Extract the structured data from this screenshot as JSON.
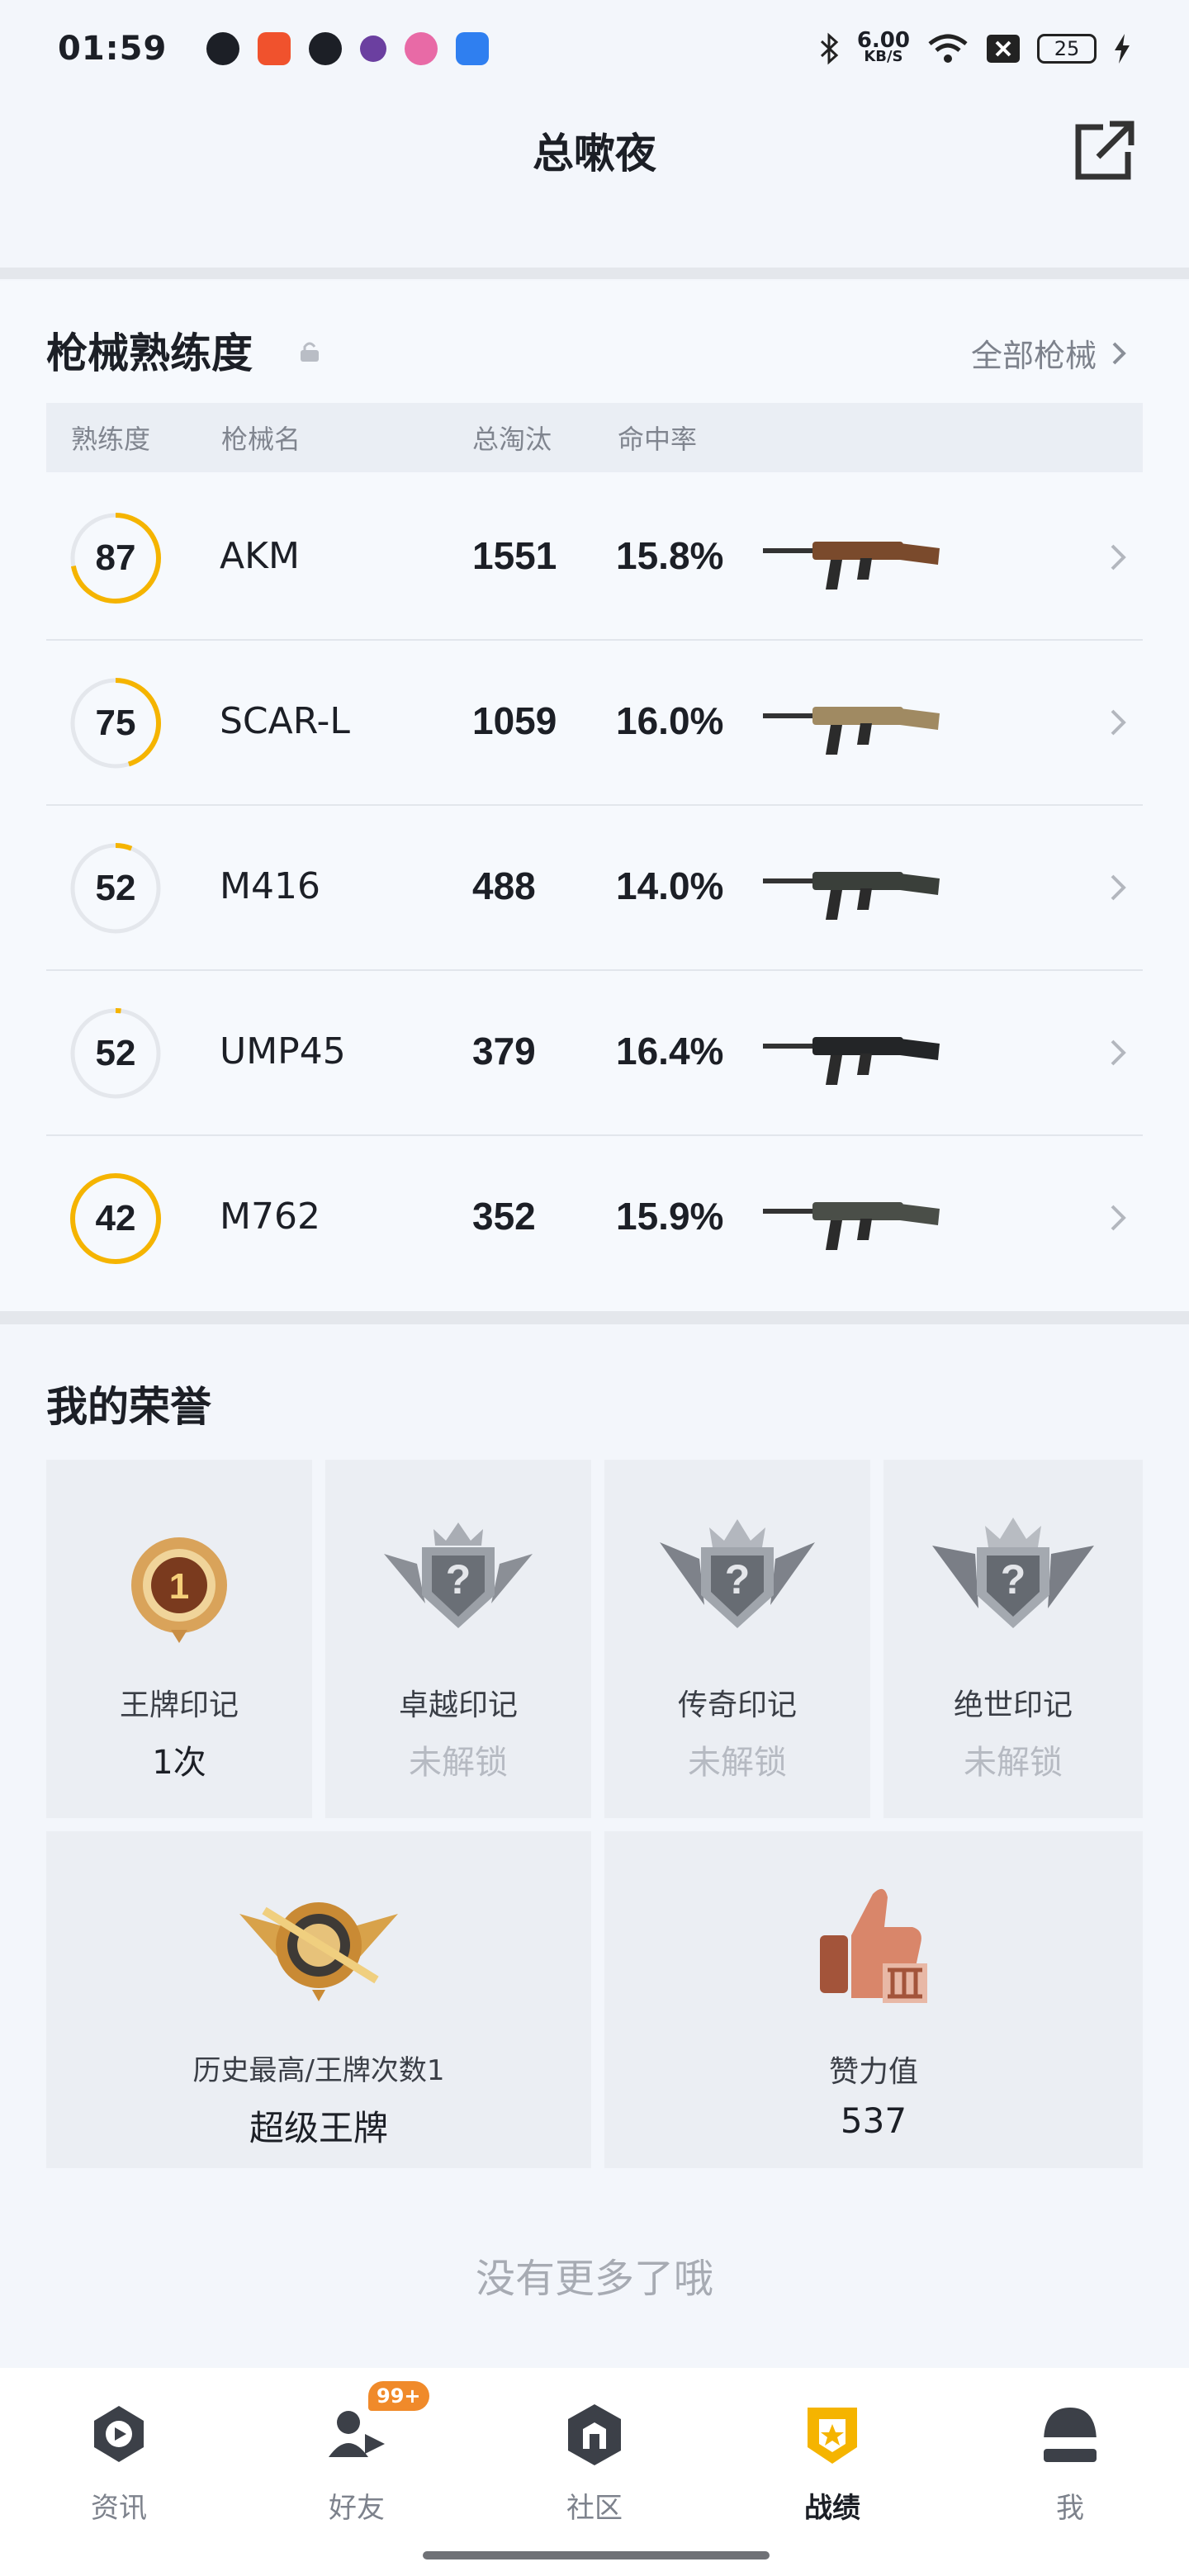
{
  "status_bar": {
    "time": "01:59",
    "speed_value": "6.00",
    "speed_unit": "KB/S",
    "battery": "25",
    "icons": [
      "wechat-icon",
      "video-icon",
      "tiktok-icon",
      "app-icon",
      "flower-icon",
      "bluetooth-app-icon",
      "bluetooth-icon",
      "wifi-icon",
      "no-sim-icon",
      "charging-icon"
    ]
  },
  "header": {
    "title": "总嗽夜",
    "share_icon": "share-external-icon"
  },
  "weapons": {
    "title": "枪械熟练度",
    "all_link": "全部枪械",
    "columns": [
      "熟练度",
      "枪械名",
      "总淘汰",
      "命中率"
    ],
    "rows": [
      {
        "level": "87",
        "progress": 0.72,
        "name": "AKM",
        "kills": "1551",
        "accuracy": "15.8%",
        "color": "#7a4a2c"
      },
      {
        "level": "75",
        "progress": 0.45,
        "name": "SCAR-L",
        "kills": "1059",
        "accuracy": "16.0%",
        "color": "#a08a62"
      },
      {
        "level": "52",
        "progress": 0.06,
        "name": "M416",
        "kills": "488",
        "accuracy": "14.0%",
        "color": "#3a3f3a"
      },
      {
        "level": "52",
        "progress": 0.02,
        "name": "UMP45",
        "kills": "379",
        "accuracy": "16.4%",
        "color": "#232527"
      },
      {
        "level": "42",
        "progress": 1.0,
        "name": "M762",
        "kills": "352",
        "accuracy": "15.9%",
        "color": "#4a4e48"
      }
    ]
  },
  "honors": {
    "title": "我的荣誉",
    "badges": [
      {
        "label": "王牌印记",
        "value": "1次",
        "locked": false
      },
      {
        "label": "卓越印记",
        "value": "未解锁",
        "locked": true
      },
      {
        "label": "传奇印记",
        "value": "未解锁",
        "locked": true
      },
      {
        "label": "绝世印记",
        "value": "未解锁",
        "locked": true
      }
    ],
    "highest": {
      "label": "历史最高/王牌次数1",
      "value": "超级王牌"
    },
    "likes": {
      "label": "赞力值",
      "value": "537"
    }
  },
  "footer_text": "没有更多了哦",
  "nav": {
    "items": [
      {
        "label": "资讯",
        "active": false
      },
      {
        "label": "好友",
        "active": false,
        "badge": "99+"
      },
      {
        "label": "社区",
        "active": false
      },
      {
        "label": "战绩",
        "active": true
      },
      {
        "label": "我",
        "active": false
      }
    ]
  },
  "colors": {
    "accent": "#f5b400",
    "ring_track": "#e4e7ec",
    "badge": "#f08a2a"
  }
}
